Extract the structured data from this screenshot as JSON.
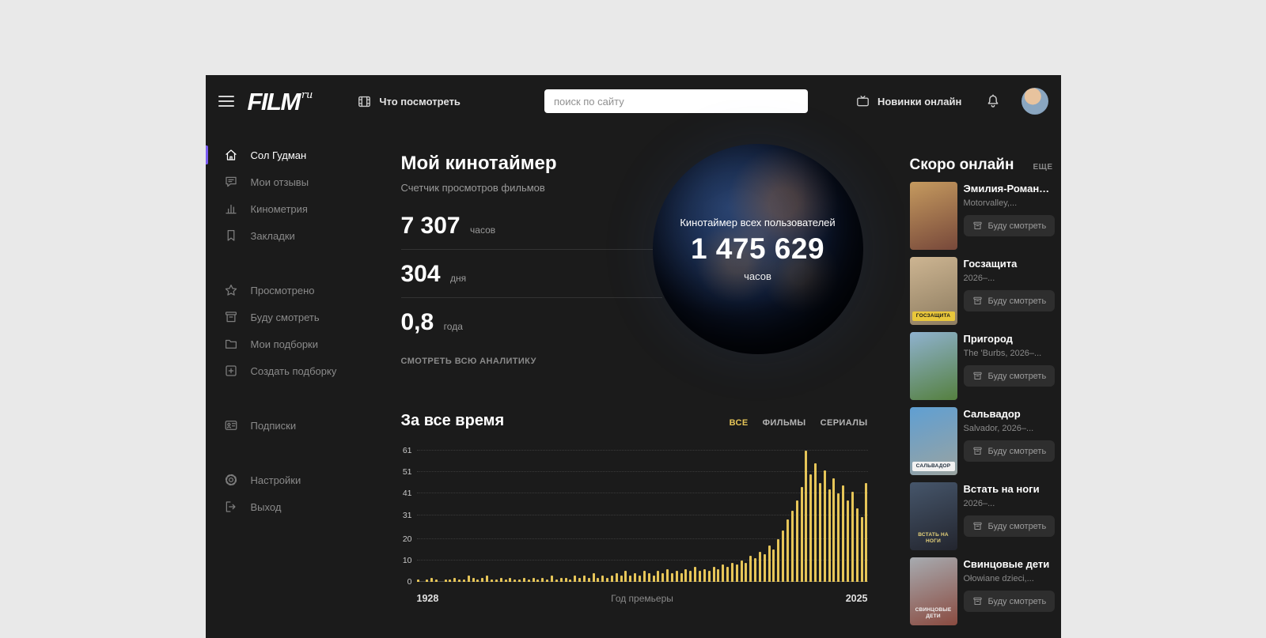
{
  "header": {
    "logo": "FILM",
    "logo_sup": "ru",
    "what_to_watch": "Что посмотреть",
    "search_placeholder": "поиск по сайту",
    "new_online": "Новинки онлайн"
  },
  "sidebar": {
    "items": [
      {
        "label": "Сол Гудман",
        "icon": "home-icon",
        "active": true
      },
      {
        "label": "Мои отзывы",
        "icon": "reviews-icon"
      },
      {
        "label": "Кинометрия",
        "icon": "chart-icon"
      },
      {
        "label": "Закладки",
        "icon": "bookmark-icon"
      },
      {
        "label": "Просмотрено",
        "icon": "star-icon",
        "gap": true
      },
      {
        "label": "Буду смотреть",
        "icon": "watchlist-icon"
      },
      {
        "label": "Мои подборки",
        "icon": "folder-icon"
      },
      {
        "label": "Создать подборку",
        "icon": "plus-icon"
      },
      {
        "label": "Подписки",
        "icon": "subscriptions-icon",
        "gap": true
      },
      {
        "label": "Настройки",
        "icon": "settings-icon",
        "gap": true
      },
      {
        "label": "Выход",
        "icon": "logout-icon"
      }
    ]
  },
  "timer": {
    "title": "Мой кинотаймер",
    "subtitle": "Счетчик просмотров фильмов",
    "stats": [
      {
        "value": "7 307",
        "unit": "часов"
      },
      {
        "value": "304",
        "unit": "дня"
      },
      {
        "value": "0,8",
        "unit": "года"
      }
    ],
    "analytics_link": "СМОТРЕТЬ ВСЮ АНАЛИТИКУ",
    "globe": {
      "caption": "Кинотаймер всех пользователей",
      "value": "1 475 629",
      "unit": "часов"
    }
  },
  "chart_data": {
    "type": "bar",
    "title": "За все время",
    "tabs": [
      "ВСЕ",
      "ФИЛЬМЫ",
      "СЕРИАЛЫ"
    ],
    "active_tab": "ВСЕ",
    "xlabel": "Год премьеры",
    "x_start": 1928,
    "x_end": 2025,
    "y_ticks": [
      0,
      10,
      20,
      31,
      41,
      51,
      61
    ],
    "ylim": [
      0,
      61
    ],
    "bar_color": "#e6c558",
    "grid": "dotted",
    "values": [
      1,
      0,
      1,
      2,
      1,
      0,
      1,
      1,
      2,
      1,
      1,
      3,
      2,
      1,
      2,
      3,
      1,
      1,
      2,
      1,
      2,
      1,
      1,
      2,
      1,
      2,
      1,
      2,
      1,
      3,
      1,
      2,
      2,
      1,
      3,
      2,
      3,
      2,
      4,
      2,
      3,
      2,
      3,
      4,
      3,
      5,
      3,
      4,
      3,
      5,
      4,
      3,
      5,
      4,
      6,
      4,
      5,
      4,
      6,
      5,
      7,
      5,
      6,
      5,
      7,
      6,
      8,
      7,
      9,
      8,
      10,
      9,
      12,
      11,
      14,
      13,
      17,
      15,
      20,
      24,
      29,
      33,
      38,
      44,
      61,
      50,
      55,
      46,
      52,
      43,
      48,
      41,
      45,
      38,
      42,
      34,
      30,
      46
    ]
  },
  "soon": {
    "title": "Скоро онлайн",
    "more_label": "ЕЩЕ",
    "watch_button": "Буду смотреть",
    "items": [
      {
        "title": "Эмилия-Романья:...",
        "subtitle": "Motorvalley,...",
        "poster": {
          "from": "#c59a5f",
          "to": "#77483a",
          "label": "",
          "label_bg": "",
          "label_color": ""
        }
      },
      {
        "title": "Госзащита",
        "subtitle": "2026–...",
        "poster": {
          "from": "#cdb592",
          "to": "#8d7c60",
          "label": "ГОСЗАЩИТА",
          "label_bg": "#e9c73b",
          "label_color": "#181818"
        }
      },
      {
        "title": "Пригород",
        "subtitle": "The 'Burbs, 2026–...",
        "poster": {
          "from": "#8fb2cf",
          "to": "#55803f",
          "label": "",
          "label_bg": "",
          "label_color": ""
        }
      },
      {
        "title": "Сальвадор",
        "subtitle": "Salvador, 2026–...",
        "poster": {
          "from": "#5f9fd3",
          "to": "#9aa3a0",
          "label": "САЛЬВАДОР",
          "label_bg": "#f2f2f2",
          "label_color": "#23313f"
        }
      },
      {
        "title": "Встать на ноги",
        "subtitle": "2026–...",
        "poster": {
          "from": "#46566b",
          "to": "#23252e",
          "label": "ВСТАТЬ НА НОГИ",
          "label_bg": "",
          "label_color": "#e6d27a"
        }
      },
      {
        "title": "Свинцовые дети",
        "subtitle": "Ołowiane dzieci,...",
        "poster": {
          "from": "#a7abb0",
          "to": "#8a4b40",
          "label": "СВИНЦОВЫЕ ДЕТИ",
          "label_bg": "",
          "label_color": "#f2f2f2"
        }
      }
    ]
  },
  "colors": {
    "accent_purple": "#7a5cf0",
    "bar_yellow": "#e6c558",
    "app_bg": "#1b1b1b",
    "page_bg": "#e9e9e9"
  }
}
